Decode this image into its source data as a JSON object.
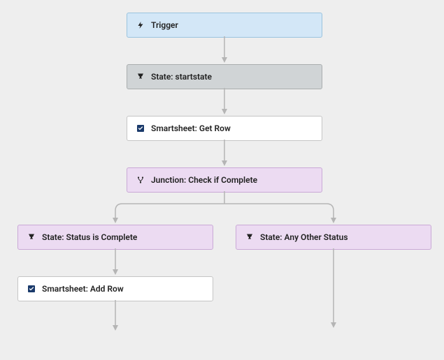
{
  "nodes": {
    "trigger": {
      "label": "Trigger"
    },
    "state_start": {
      "label": "State: startstate"
    },
    "action_getrow": {
      "label": "Smartsheet: Get Row"
    },
    "junction_check": {
      "label": "Junction: Check if Complete"
    },
    "branch_complete": {
      "label": "State: Status is Complete"
    },
    "branch_other": {
      "label": "State: Any Other Status"
    },
    "action_addrow": {
      "label": "Smartsheet: Add Row"
    }
  },
  "icons": {
    "trigger": "lightning",
    "state": "trophy",
    "smartsheet": "smartsheet-check",
    "junction": "branch"
  }
}
